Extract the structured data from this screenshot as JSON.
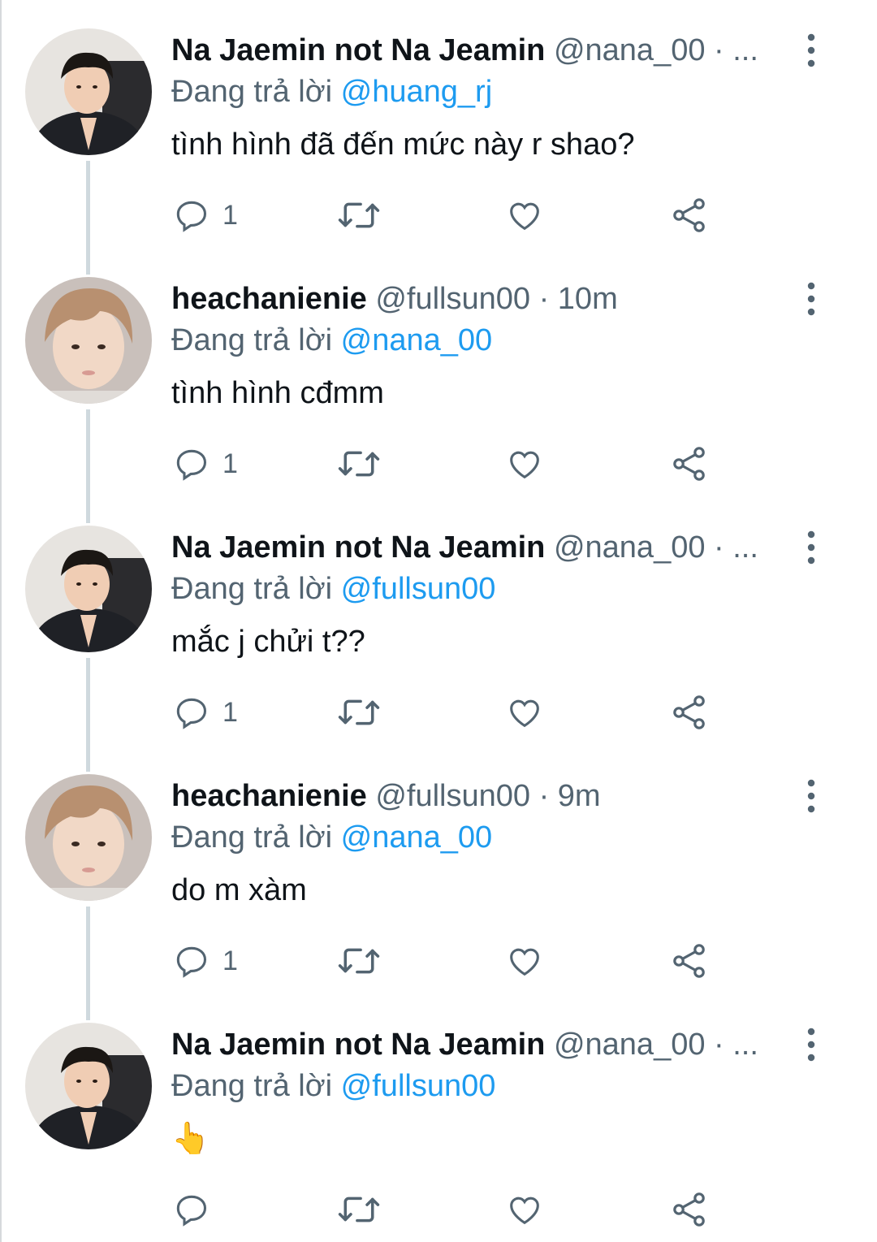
{
  "colors": {
    "link": "#1d9bf0",
    "secondary_text": "#536471",
    "primary_text": "#0f1419",
    "thread_line": "#cfd9de"
  },
  "replying_label": "Đang trả lời",
  "tweets": [
    {
      "display_name": "Na Jaemin not Na Jeamin",
      "handle": "@nana_00",
      "separator": "·",
      "time": "...",
      "reply_to": "@huang_rj",
      "text": "tình hình đã đến mức này r shao?",
      "reply_count": "1",
      "avatar": "avatar-dark-hair-praying-hands"
    },
    {
      "display_name": "heachanienie",
      "handle": "@fullsun00",
      "separator": "·",
      "time": "10m",
      "reply_to": "@nana_00",
      "text": "tình hình cđmm",
      "reply_count": "1",
      "avatar": "avatar-light-hair-portrait"
    },
    {
      "display_name": "Na Jaemin not Na Jeamin",
      "handle": "@nana_00",
      "separator": "·",
      "time": "...",
      "reply_to": "@fullsun00",
      "text": "mắc j chửi t??",
      "reply_count": "1",
      "avatar": "avatar-dark-hair-praying-hands"
    },
    {
      "display_name": "heachanienie",
      "handle": "@fullsun00",
      "separator": "·",
      "time": "9m",
      "reply_to": "@nana_00",
      "text": "do m xàm",
      "reply_count": "1",
      "avatar": "avatar-light-hair-portrait"
    },
    {
      "display_name": "Na Jaemin not Na Jeamin",
      "handle": "@nana_00",
      "separator": "·",
      "time": "...",
      "reply_to": "@fullsun00",
      "text": "👆",
      "reply_count": "",
      "avatar": "avatar-dark-hair-praying-hands"
    }
  ],
  "icons": {
    "reply": "reply-bubble-icon",
    "retweet": "retweet-icon",
    "like": "heart-icon",
    "share": "share-icon",
    "more": "more-vertical-icon"
  }
}
